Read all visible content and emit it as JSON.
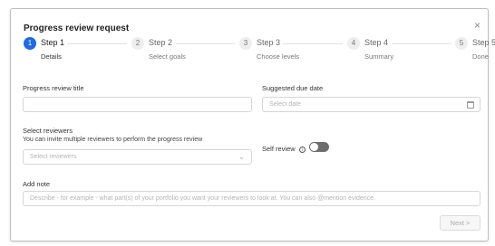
{
  "dialog": {
    "title": "Progress review request",
    "close_glyph": "×"
  },
  "steps": [
    {
      "number": "1",
      "name": "Step 1",
      "sub": "Details",
      "active": true
    },
    {
      "number": "2",
      "name": "Step 2",
      "sub": "Select goals",
      "active": false
    },
    {
      "number": "3",
      "name": "Step 3",
      "sub": "Choose levels",
      "active": false
    },
    {
      "number": "4",
      "name": "Step 4",
      "sub": "Summary",
      "active": false
    },
    {
      "number": "5",
      "name": "Step 5",
      "sub": "Done",
      "active": false
    }
  ],
  "form": {
    "title_label": "Progress review title",
    "title_value": "",
    "due_label": "Suggested due date",
    "due_placeholder": "Select date",
    "calendar_icon": "calendar-icon",
    "reviewers_label": "Select reviewers",
    "reviewers_help": "You can invite multiple reviewers to perform the progress review",
    "reviewers_placeholder": "Select reviewers",
    "reviewers_chevron": "⌄",
    "self_review_label": "Self review",
    "self_review_info_glyph": "i",
    "self_review_on": false,
    "note_label": "Add note",
    "note_placeholder": "Describe - for example - what part(s) of your portfolio you want your reviewers to look at. You can also @mention evidence."
  },
  "footer": {
    "next_label": "Next  >"
  },
  "colors": {
    "accent": "#1d6ae5",
    "toggle_off": "#6e6e6e"
  }
}
